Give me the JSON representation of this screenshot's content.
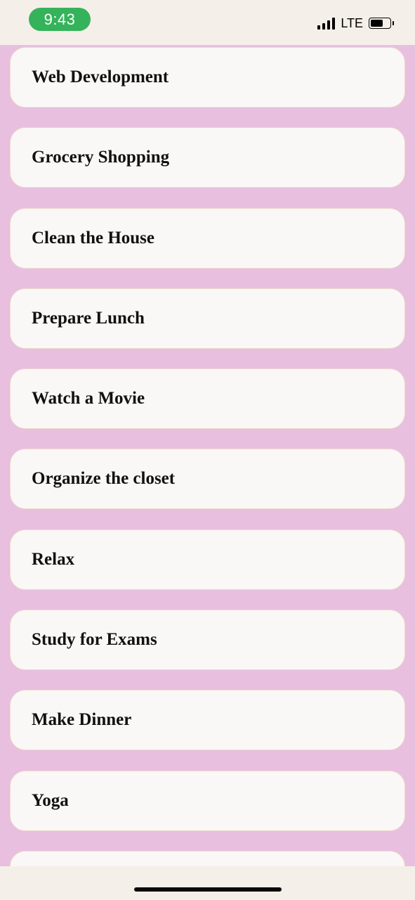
{
  "status_bar": {
    "time": "9:43",
    "network": "LTE",
    "signal_icon": "cellular-signal-icon",
    "battery_icon": "battery-icon",
    "time_pill_color": "#34b35a",
    "battery_level": 0.55
  },
  "theme": {
    "list_background": "#e8bfdf",
    "card_background": "#faf8f6",
    "chrome_background": "#f5efe9"
  },
  "tasks": [
    {
      "label": "Web Development"
    },
    {
      "label": "Grocery Shopping"
    },
    {
      "label": "Clean the House"
    },
    {
      "label": "Prepare Lunch"
    },
    {
      "label": "Watch a Movie"
    },
    {
      "label": "Organize the closet"
    },
    {
      "label": "Relax"
    },
    {
      "label": "Study for Exams"
    },
    {
      "label": "Make Dinner"
    },
    {
      "label": "Yoga"
    },
    {
      "label": ""
    }
  ]
}
